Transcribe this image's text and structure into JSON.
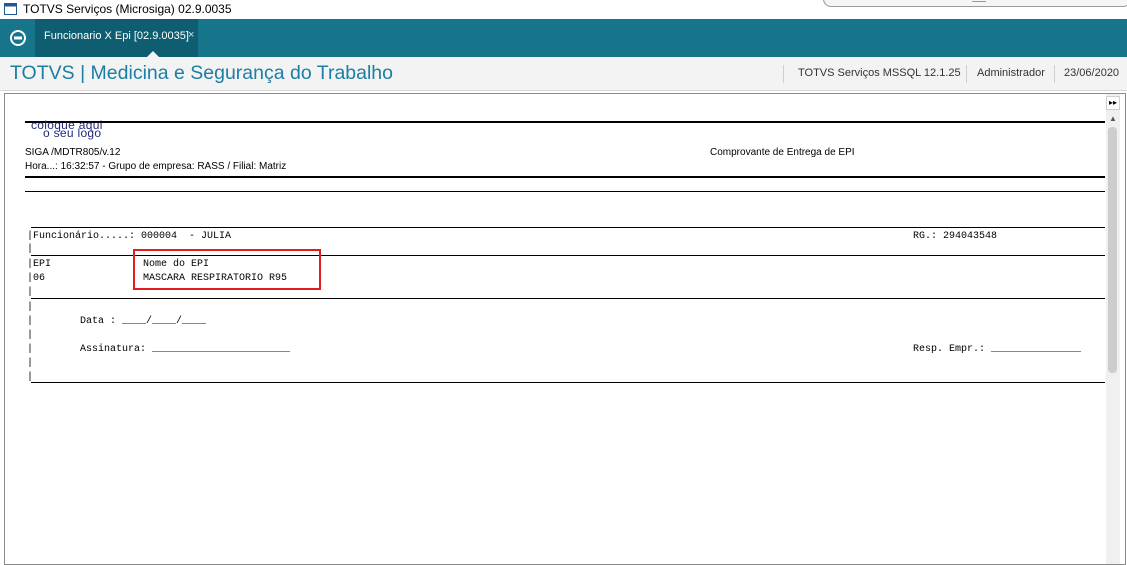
{
  "window": {
    "title": "TOTVS Serviços (Microsiga) 02.9.0035"
  },
  "tabs": [
    {
      "label": "Funcionario X Epi [02.9.0035]",
      "close": "×"
    }
  ],
  "header": {
    "module_title": "TOTVS | Medicina e Segurança do Trabalho",
    "environment": "TOTVS Serviços MSSQL 12.1.25",
    "user": "Administrador",
    "date": "23/06/2020"
  },
  "report": {
    "logo_line1": "coloque aqui",
    "logo_line2": "o seu logo",
    "program": "SIGA /MDTR805/v.12",
    "doc_title": "Comprovante de Entrega de EPI",
    "time_line": "Hora...: 16:32:57 - Grupo de empresa: RASS / Filial: Matriz",
    "employee_line": "|Funcionário.....: 000004  - JULIA",
    "rg_line": "RG.: 294043548",
    "epi_header_code": "|EPI",
    "epi_header_name": "Nome do EPI",
    "epi_row_code": "|06",
    "epi_row_name": "MASCARA RESPIRATORIO R95",
    "date_line": "Data : ____/____/____",
    "signature_line": "Assinatura: _______________________",
    "resp_line": "Resp. Empr.: _______________",
    "pipe": "|"
  },
  "colors": {
    "tabbar": "#17758b",
    "active_tab": "#0e5d70",
    "title_blue": "#1b7ea3",
    "highlight": "#e31d1d"
  },
  "icons": {
    "app": "window-icon",
    "home": "totvs-home-icon",
    "scroll_end": "double-chevron-right-icon",
    "scroll_up": "triangle-up-icon"
  }
}
